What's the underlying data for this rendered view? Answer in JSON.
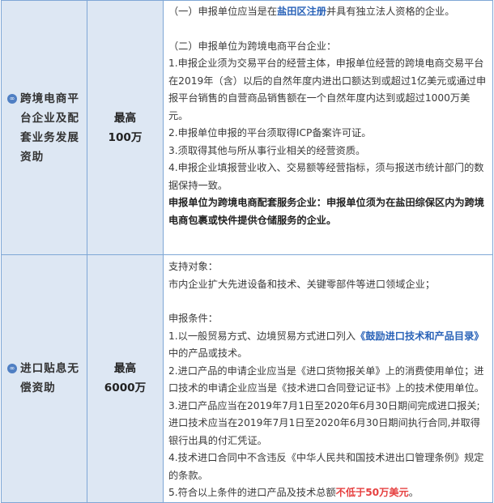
{
  "row1": {
    "category": "跨境电商平台企业及配套业务发展资助",
    "amount_line1": "最高",
    "amount_line2": "100万",
    "p1_pre": "（一）申报单位应当是在",
    "p1_link": "盐田区注册",
    "p1_post": "并具有独立法人资格的企业。",
    "p2": "（二）申报单位为跨境电商平台企业：",
    "item1": "1.申报企业须为交易平台的经营主体，申报单位经营的跨境电商交易平台在2019年（含）以后的自然年度内进出口额达到或超过1亿美元或通过申报平台销售的自营商品销售额在一个自然年度内达到或超过1000万美元。",
    "item2": "2.申报单位申报的平台须取得ICP备案许可证。",
    "item3": "3.须取得其他与所从事行业相关的经营资质。",
    "item4": "4.申报企业填报营业收入、交易额等经营指标，须与报送市统计部门的数据保持一致。",
    "note": "申报单位为跨境电商配套服务企业：申报单位须为在盐田综保区内为跨境电商包裹或快件提供仓储服务的企业。"
  },
  "row2": {
    "category": "进口贴息无偿资助",
    "amount_line1": "最高",
    "amount_line2": "6000万",
    "target_label": "支持对象：",
    "target": "市内企业扩大先进设备和技术、关键零部件等进口领域企业；",
    "cond_label": "申报条件：",
    "c1_pre": "1.以一般贸易方式、边境贸易方式进口列入",
    "c1_link": "《鼓励进口技术和产品目录》",
    "c1_post": "中的产品或技术。",
    "c2": "2.进口产品的申请企业应当是《进口货物报关单》上的消费使用单位；进口技术的申请企业应当是《技术进口合同登记证书》上的技术使用单位。",
    "c3": "3.进口产品应当在2019年7月1日至2020年6月30日期间完成进口报关;进口技术应当在2019年7月1日至2020年6月30日期间执行合同,并取得银行出具的付汇凭证。",
    "c4": "4.技术进口合同中不含违反《中华人民共和国技术进出口管理条例》规定的条款。",
    "c5_pre": "5.符合以上条件的进口产品及技术总额",
    "c5_red": "不低于50万美元",
    "c5_post": "。"
  },
  "colors": {
    "header_bg": "#dde7f3",
    "border": "#7fa7d6",
    "link_blue": "#2a63b8",
    "alert_red": "#e64040"
  },
  "icons": {
    "category": "link-icon"
  }
}
